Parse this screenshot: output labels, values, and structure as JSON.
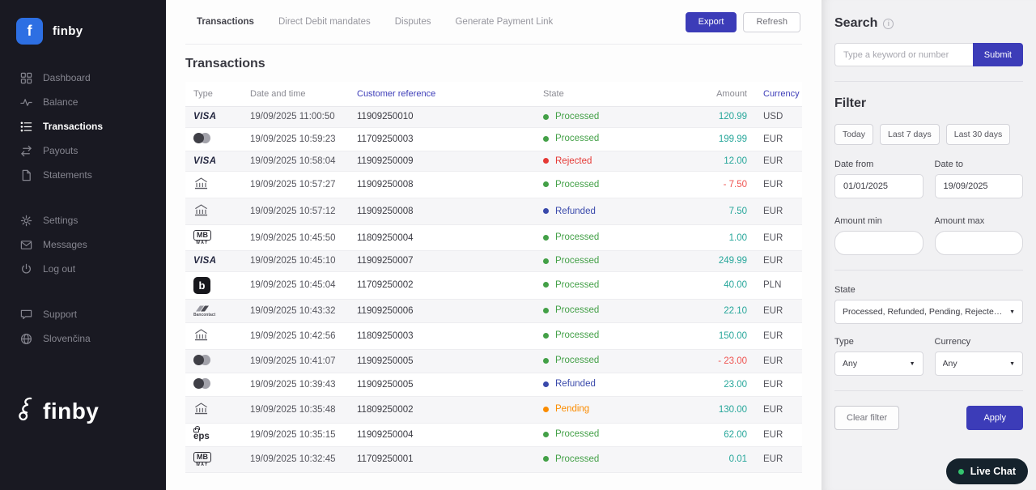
{
  "colors": {
    "accent": "#3c3cb8",
    "brand_tile": "#2d6fe3",
    "amount_positive": "#26a69a",
    "amount_negative": "#ef5350",
    "state": {
      "Processed": "#43a047",
      "Rejected": "#e53935",
      "Refunded": "#3949ab",
      "Pending": "#fb8c00"
    }
  },
  "sidebar": {
    "brand": "finby",
    "nav": [
      {
        "label": "Dashboard",
        "icon": "dashboard-icon",
        "active": false
      },
      {
        "label": "Balance",
        "icon": "balance-icon",
        "active": false
      },
      {
        "label": "Transactions",
        "icon": "transactions-icon",
        "active": true
      },
      {
        "label": "Payouts",
        "icon": "payouts-icon",
        "active": false
      },
      {
        "label": "Statements",
        "icon": "statements-icon",
        "active": false
      }
    ],
    "secondary": [
      {
        "label": "Settings",
        "icon": "gear-icon"
      },
      {
        "label": "Messages",
        "icon": "envelope-icon"
      },
      {
        "label": "Log out",
        "icon": "power-icon"
      }
    ],
    "tertiary": [
      {
        "label": "Support",
        "icon": "chat-bubble-icon"
      },
      {
        "label": "Slovenčina",
        "icon": "globe-icon"
      }
    ],
    "footer_logo": "finby"
  },
  "header": {
    "tabs": [
      {
        "label": "Transactions",
        "active": true
      },
      {
        "label": "Direct Debit mandates",
        "active": false
      },
      {
        "label": "Disputes",
        "active": false
      },
      {
        "label": "Generate Payment Link",
        "active": false
      }
    ],
    "export_label": "Export",
    "refresh_label": "Refresh"
  },
  "page_title": "Transactions",
  "table": {
    "headers": [
      {
        "label": "Type"
      },
      {
        "label": "Date and time"
      },
      {
        "label": "Customer reference",
        "accent": true
      },
      {
        "label": "State"
      },
      {
        "label": "Amount",
        "align": "right"
      },
      {
        "label": "Currency",
        "accent": true
      }
    ],
    "rows": [
      {
        "type": "visa",
        "datetime": "19/09/2025 11:00:50",
        "reference": "11909250010",
        "state": "Processed",
        "amount": "120.99",
        "negative": false,
        "currency": "USD"
      },
      {
        "type": "mastercard",
        "datetime": "19/09/2025 10:59:23",
        "reference": "11709250003",
        "state": "Processed",
        "amount": "199.99",
        "negative": false,
        "currency": "EUR"
      },
      {
        "type": "visa",
        "datetime": "19/09/2025 10:58:04",
        "reference": "11909250009",
        "state": "Rejected",
        "amount": "12.00",
        "negative": false,
        "currency": "EUR"
      },
      {
        "type": "bank",
        "datetime": "19/09/2025 10:57:27",
        "reference": "11909250008",
        "state": "Processed",
        "amount": "- 7.50",
        "negative": true,
        "currency": "EUR"
      },
      {
        "type": "bank",
        "datetime": "19/09/2025 10:57:12",
        "reference": "11909250008",
        "state": "Refunded",
        "amount": "7.50",
        "negative": false,
        "currency": "EUR"
      },
      {
        "type": "mbway",
        "datetime": "19/09/2025 10:45:50",
        "reference": "11809250004",
        "state": "Processed",
        "amount": "1.00",
        "negative": false,
        "currency": "EUR"
      },
      {
        "type": "visa",
        "datetime": "19/09/2025 10:45:10",
        "reference": "11909250007",
        "state": "Processed",
        "amount": "249.99",
        "negative": false,
        "currency": "EUR"
      },
      {
        "type": "blik",
        "datetime": "19/09/2025 10:45:04",
        "reference": "11709250002",
        "state": "Processed",
        "amount": "40.00",
        "negative": false,
        "currency": "PLN"
      },
      {
        "type": "bancontact",
        "datetime": "19/09/2025 10:43:32",
        "reference": "11909250006",
        "state": "Processed",
        "amount": "22.10",
        "negative": false,
        "currency": "EUR"
      },
      {
        "type": "bank",
        "datetime": "19/09/2025 10:42:56",
        "reference": "11809250003",
        "state": "Processed",
        "amount": "150.00",
        "negative": false,
        "currency": "EUR"
      },
      {
        "type": "mastercard",
        "datetime": "19/09/2025 10:41:07",
        "reference": "11909250005",
        "state": "Processed",
        "amount": "- 23.00",
        "negative": true,
        "currency": "EUR"
      },
      {
        "type": "mastercard",
        "datetime": "19/09/2025 10:39:43",
        "reference": "11909250005",
        "state": "Refunded",
        "amount": "23.00",
        "negative": false,
        "currency": "EUR"
      },
      {
        "type": "bank",
        "datetime": "19/09/2025 10:35:48",
        "reference": "11809250002",
        "state": "Pending",
        "amount": "130.00",
        "negative": false,
        "currency": "EUR"
      },
      {
        "type": "eps",
        "datetime": "19/09/2025 10:35:15",
        "reference": "11909250004",
        "state": "Processed",
        "amount": "62.00",
        "negative": false,
        "currency": "EUR"
      },
      {
        "type": "mbway",
        "datetime": "19/09/2025 10:32:45",
        "reference": "11709250001",
        "state": "Processed",
        "amount": "0.01",
        "negative": false,
        "currency": "EUR"
      }
    ]
  },
  "search": {
    "title": "Search",
    "placeholder": "Type a keyword or number",
    "submit_label": "Submit"
  },
  "filter": {
    "title": "Filter",
    "quick_ranges": [
      "Today",
      "Last 7 days",
      "Last 30 days"
    ],
    "date_from_label": "Date from",
    "date_to_label": "Date to",
    "date_from_value": "01/01/2025",
    "date_to_value": "19/09/2025",
    "amount_min_label": "Amount min",
    "amount_max_label": "Amount max",
    "state_label": "State",
    "state_value": "Processed, Refunded, Pending, Rejected,…",
    "type_label": "Type",
    "type_value": "Any",
    "currency_label": "Currency",
    "currency_value": "Any",
    "clear_label": "Clear filter",
    "apply_label": "Apply"
  },
  "live_chat": {
    "label": "Live Chat"
  }
}
